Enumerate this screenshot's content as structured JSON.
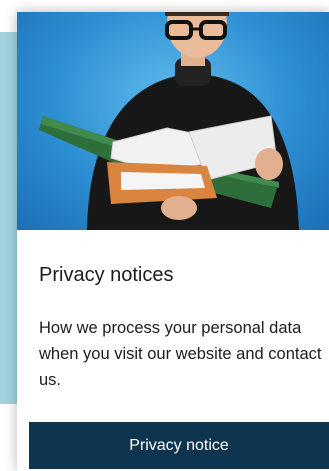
{
  "card": {
    "image_alt": "Man in glasses looking through folders",
    "title": "Privacy notices",
    "description": "How we process your personal data when you visit our website and contact us.",
    "button_label": "Privacy notice"
  },
  "colors": {
    "accent_band": "#a3d4de",
    "button_bg": "#0e3550",
    "image_bg": "#2d8fd3"
  }
}
